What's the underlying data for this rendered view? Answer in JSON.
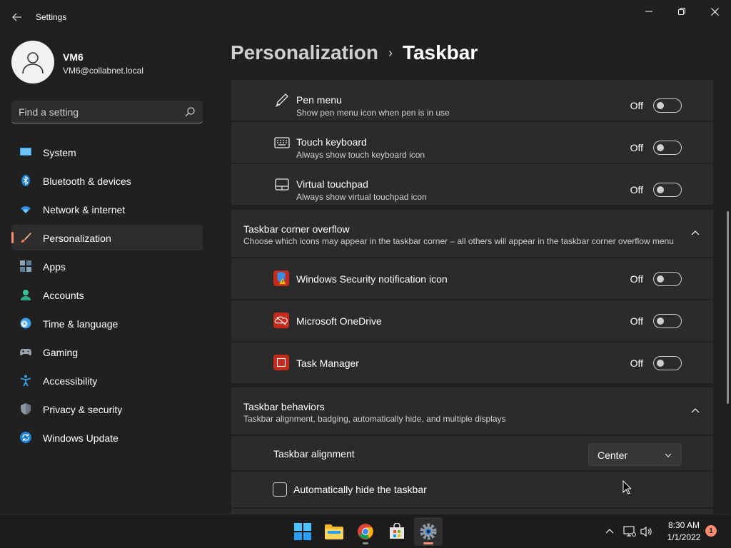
{
  "window": {
    "app_title": "Settings",
    "controls": {
      "minimize": "minimize",
      "maximize": "maximize",
      "close": "close"
    }
  },
  "profile": {
    "name": "VM6",
    "email": "VM6@collabnet.local"
  },
  "search": {
    "placeholder": "Find a setting"
  },
  "sidebar": {
    "items": [
      {
        "label": "System",
        "icon": "monitor-icon"
      },
      {
        "label": "Bluetooth & devices",
        "icon": "bluetooth-icon"
      },
      {
        "label": "Network & internet",
        "icon": "wifi-icon"
      },
      {
        "label": "Personalization",
        "icon": "brush-icon",
        "selected": true
      },
      {
        "label": "Apps",
        "icon": "apps-icon"
      },
      {
        "label": "Accounts",
        "icon": "person-icon"
      },
      {
        "label": "Time & language",
        "icon": "clock-globe-icon"
      },
      {
        "label": "Gaming",
        "icon": "controller-icon"
      },
      {
        "label": "Accessibility",
        "icon": "accessibility-icon"
      },
      {
        "label": "Privacy & security",
        "icon": "shield-icon"
      },
      {
        "label": "Windows Update",
        "icon": "update-icon"
      }
    ]
  },
  "header": {
    "parent": "Personalization",
    "separator": "›",
    "current": "Taskbar"
  },
  "corner_icons": [
    {
      "title": "Pen menu",
      "desc": "Show pen menu icon when pen is in use",
      "state": "Off"
    },
    {
      "title": "Touch keyboard",
      "desc": "Always show touch keyboard icon",
      "state": "Off"
    },
    {
      "title": "Virtual touchpad",
      "desc": "Always show virtual touchpad icon",
      "state": "Off"
    }
  ],
  "overflow": {
    "title": "Taskbar corner overflow",
    "desc": "Choose which icons may appear in the taskbar corner – all others will appear in the taskbar corner overflow menu",
    "items": [
      {
        "title": "Windows Security notification icon",
        "state": "Off"
      },
      {
        "title": "Microsoft OneDrive",
        "state": "Off"
      },
      {
        "title": "Task Manager",
        "state": "Off"
      }
    ]
  },
  "behaviors": {
    "title": "Taskbar behaviors",
    "desc": "Taskbar alignment, badging, automatically hide, and multiple displays",
    "alignment_label": "Taskbar alignment",
    "alignment_value": "Center",
    "autohide_label": "Automatically hide the taskbar"
  },
  "taskbar": {
    "time": "8:30 AM",
    "date": "1/1/2022",
    "notification_count": "1"
  },
  "colors": {
    "accent": "#ff8f73",
    "background": "#202020",
    "card": "#2b2b2b"
  }
}
